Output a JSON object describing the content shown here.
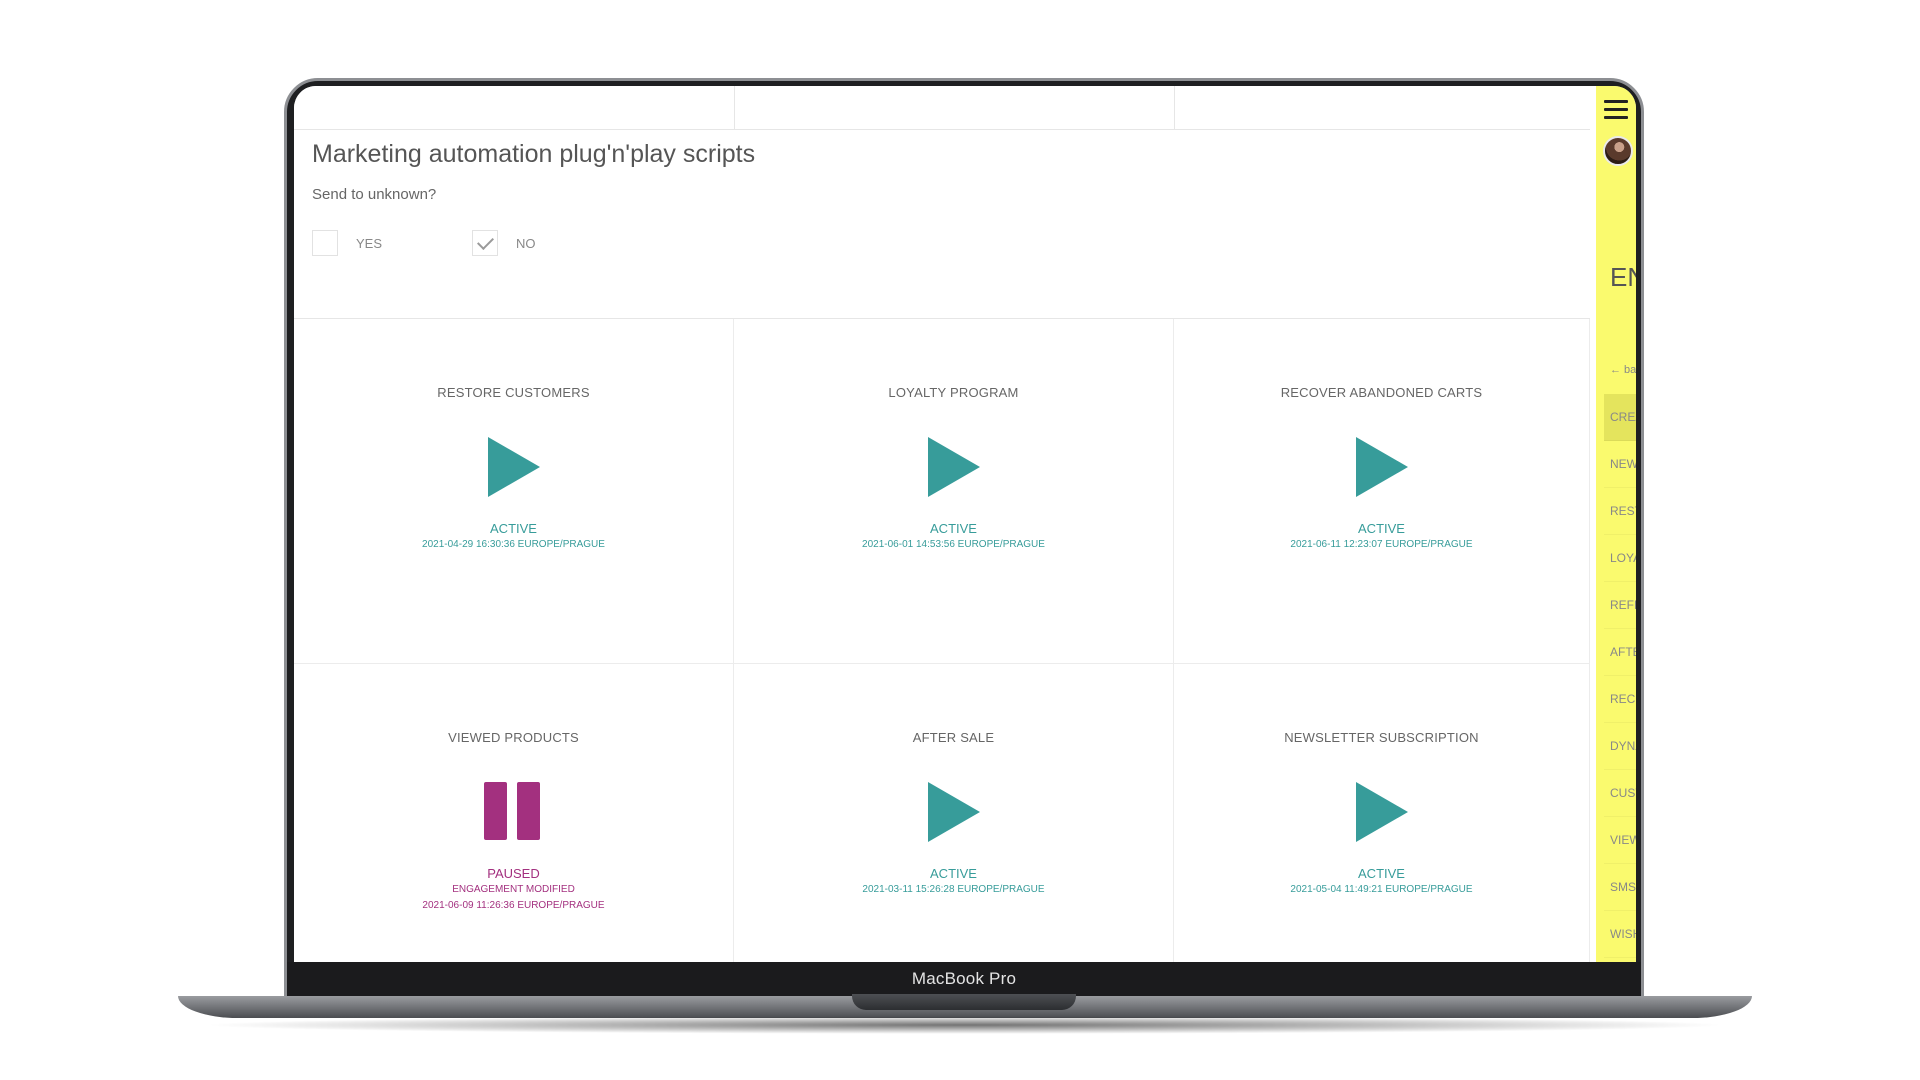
{
  "device": {
    "label": "MacBook Pro"
  },
  "page": {
    "title": "Marketing automation plug'n'play scripts",
    "question": "Send to unknown?",
    "options": [
      {
        "label": "YES",
        "checked": false
      },
      {
        "label": "NO",
        "checked": true
      }
    ]
  },
  "cards": [
    {
      "title": "RESTORE CUSTOMERS",
      "icon": "play-icon",
      "status": "ACTIVE",
      "lines": [
        "2021-04-29 16:30:36 EUROPE/PRAGUE"
      ]
    },
    {
      "title": "LOYALTY PROGRAM",
      "icon": "play-icon",
      "status": "ACTIVE",
      "lines": [
        "2021-06-01 14:53:56 EUROPE/PRAGUE"
      ]
    },
    {
      "title": "RECOVER ABANDONED CARTS",
      "icon": "play-icon",
      "status": "ACTIVE",
      "lines": [
        "2021-06-11 12:23:07 EUROPE/PRAGUE"
      ]
    },
    {
      "title": "VIEWED PRODUCTS",
      "icon": "pause-icon",
      "status": "PAUSED",
      "lines": [
        "ENGAGEMENT MODIFIED",
        "2021-06-09 11:26:36 EUROPE/PRAGUE"
      ]
    },
    {
      "title": "AFTER SALE",
      "icon": "play-icon",
      "status": "ACTIVE",
      "lines": [
        "2021-03-11 15:26:28 EUROPE/PRAGUE"
      ]
    },
    {
      "title": "NEWSLETTER SUBSCRIPTION",
      "icon": "play-icon",
      "status": "ACTIVE",
      "lines": [
        "2021-05-04 11:49:21 EUROPE/PRAGUE"
      ]
    }
  ],
  "sidebar": {
    "lang": "EN",
    "back": "← ba",
    "items": [
      "CREA",
      "NEW",
      "REST",
      "LOYA",
      "REFE",
      "AFTE",
      "RECO",
      "DYNA",
      "CUST",
      "VIEW",
      "SMS",
      "WISH"
    ]
  },
  "colors": {
    "active": "#379c9a",
    "paused": "#a3307f",
    "sidebar": "#fafa6e",
    "sidebar_active": "#e4e45d"
  }
}
